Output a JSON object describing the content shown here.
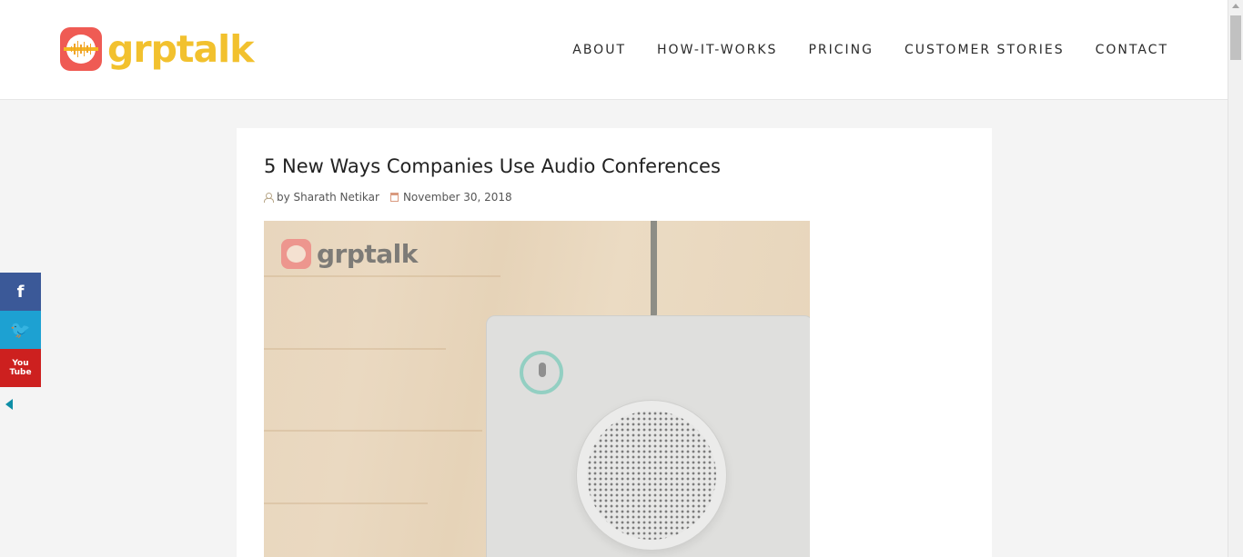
{
  "brand": {
    "name": "grptalk",
    "logo_icon": "grptalk-logo-icon",
    "color": "#f2c12e",
    "badge_color": "#ef5b54"
  },
  "nav": {
    "items": [
      {
        "label": "ABOUT"
      },
      {
        "label": "HOW-IT-WORKS"
      },
      {
        "label": "PRICING"
      },
      {
        "label": "CUSTOMER STORIES"
      },
      {
        "label": "CONTACT"
      }
    ]
  },
  "article": {
    "title": "5 New Ways Companies Use Audio Conferences",
    "author": "by Sharath Netikar",
    "date": "November 30, 2018",
    "featured_image": {
      "watermark_text": "grptalk",
      "subject": "conference-speakerphone"
    }
  },
  "social": {
    "items": [
      {
        "icon": "facebook-icon",
        "glyph": "f",
        "color": "#3b5998"
      },
      {
        "icon": "twitter-icon",
        "glyph": "🐦",
        "color": "#1da1d2"
      },
      {
        "icon": "youtube-icon",
        "top": "You",
        "bottom": "Tube",
        "color": "#cd201f"
      }
    ],
    "toggle_icon": "collapse-arrow-icon"
  }
}
